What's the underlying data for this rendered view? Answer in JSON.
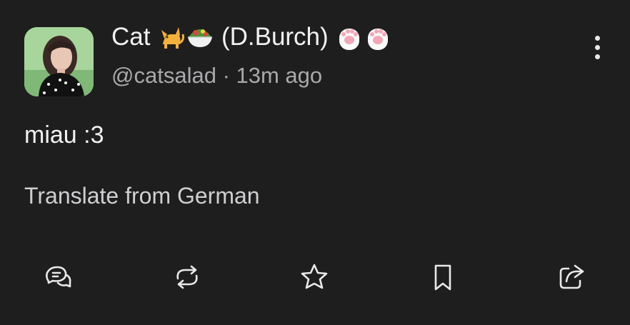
{
  "post": {
    "display_name_prefix": "Cat",
    "display_name_suffix": "(D.Burch)",
    "emoji": [
      "cat-emoji",
      "salad-emoji",
      "paw-emoji",
      "paw-emoji"
    ],
    "handle": "@catsalad",
    "separator": "·",
    "time_ago": "13m ago",
    "content": "miau :3",
    "translate_label": "Translate from German"
  },
  "actions": [
    "reply-icon",
    "boost-icon",
    "favourite-icon",
    "bookmark-icon",
    "share-icon"
  ],
  "colors": {
    "background": "#1e1e1f",
    "text": "#f1f1f1",
    "muted": "#a9a9ab"
  }
}
